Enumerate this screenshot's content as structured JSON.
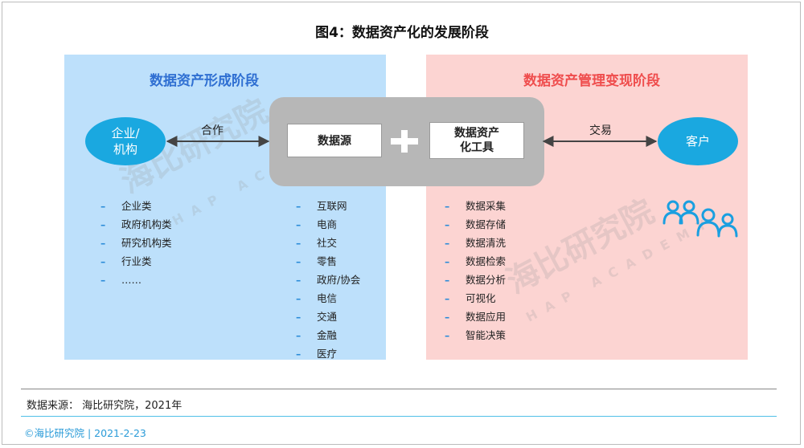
{
  "title": "图4：数据资产化的发展阶段",
  "left_panel": {
    "title": "数据资产形成阶段",
    "entity": "企业/\n机构",
    "items": [
      "企业类",
      "政府机构类",
      "研究机构类",
      "行业类",
      "……"
    ]
  },
  "right_panel": {
    "title": "数据资产管理变现阶段",
    "entity": "客户",
    "items": [
      "数据采集",
      "数据存储",
      "数据清洗",
      "数据检索",
      "数据分析",
      "可视化",
      "数据应用",
      "智能决策"
    ]
  },
  "center": {
    "source_box": "数据源",
    "tools_box": "数据资产\n化工具",
    "source_items": [
      "互联网",
      "电商",
      "社交",
      "零售",
      "政府/协会",
      "电信",
      "交通",
      "金融",
      "医疗"
    ]
  },
  "arrows": {
    "left_label": "合作",
    "right_label": "交易"
  },
  "watermark": {
    "cn": "海比研究院",
    "en": "HAP ACADEMY"
  },
  "footer": {
    "source": "数据来源： 海比研究院，2021年",
    "copyright": "©海比研究院  |  2021-2-23"
  },
  "colors": {
    "left_panel_bg": "#bde0fb",
    "right_panel_bg": "#fcd4d2",
    "ellipse": "#1aa8e0",
    "left_title": "#2f6fd2",
    "right_title": "#ef4d4d",
    "accent_line": "#4fc0e8"
  }
}
